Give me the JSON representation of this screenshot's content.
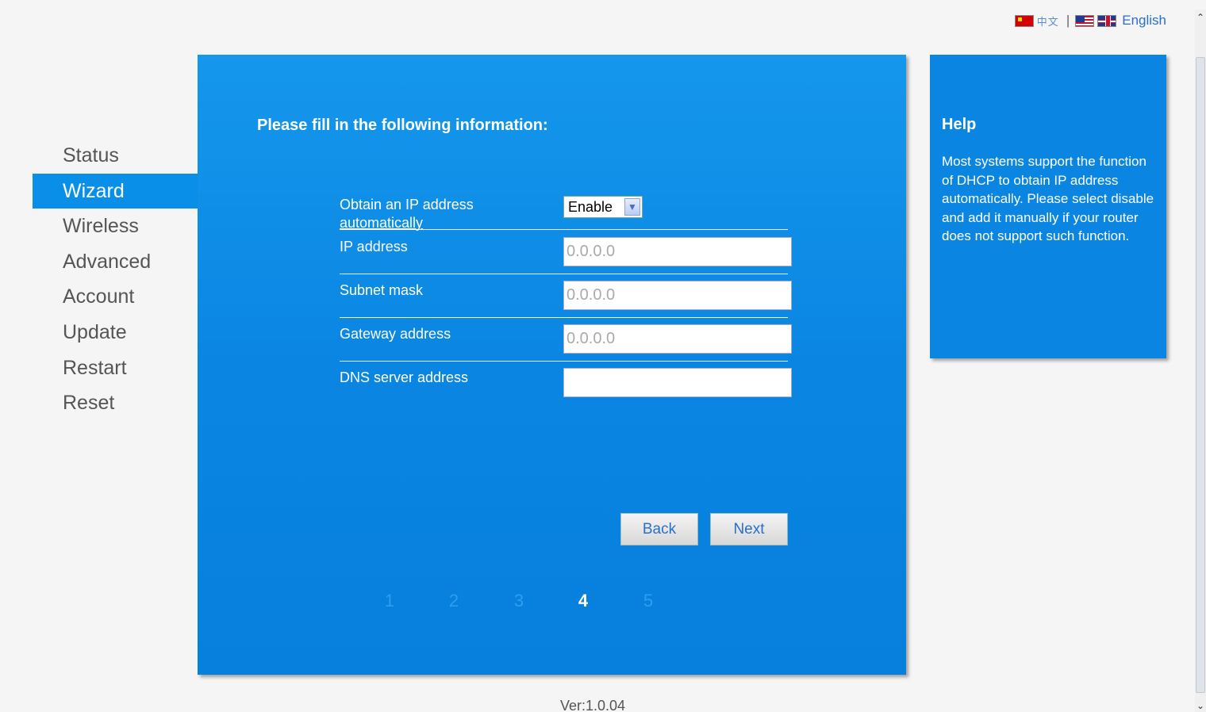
{
  "language": {
    "cn_label": "中文",
    "separator": "|",
    "en_label": "English"
  },
  "sidebar": {
    "items": [
      {
        "label": "Status"
      },
      {
        "label": "Wizard",
        "active": true
      },
      {
        "label": "Wireless"
      },
      {
        "label": "Advanced"
      },
      {
        "label": "Account"
      },
      {
        "label": "Update"
      },
      {
        "label": "Restart"
      },
      {
        "label": "Reset"
      }
    ]
  },
  "main": {
    "title": "Please fill in the following information:",
    "fields": {
      "obtain_ip": {
        "label_line1": "Obtain an IP address",
        "label_line2": "automatically",
        "value": "Enable"
      },
      "ip_address": {
        "label": "IP address",
        "value": "0.0.0.0"
      },
      "subnet_mask": {
        "label": "Subnet mask",
        "value": "0.0.0.0"
      },
      "gateway": {
        "label": "Gateway address",
        "value": "0.0.0.0"
      },
      "dns": {
        "label": "DNS server address",
        "value": ""
      }
    },
    "buttons": {
      "back": "Back",
      "next": "Next"
    },
    "steps": [
      "1",
      "2",
      "3",
      "4",
      "5"
    ],
    "current_step": "4"
  },
  "help": {
    "title": "Help",
    "text": "Most systems support the function of DHCP to obtain IP address automatically. Please select disable and add it manually if your router does not support such function."
  },
  "footer": {
    "version": "Ver:1.0.04"
  },
  "colors": {
    "panel_blue": "#0a86e2",
    "active_nav": "#0a8fe8",
    "link_blue": "#2a6fc9"
  }
}
